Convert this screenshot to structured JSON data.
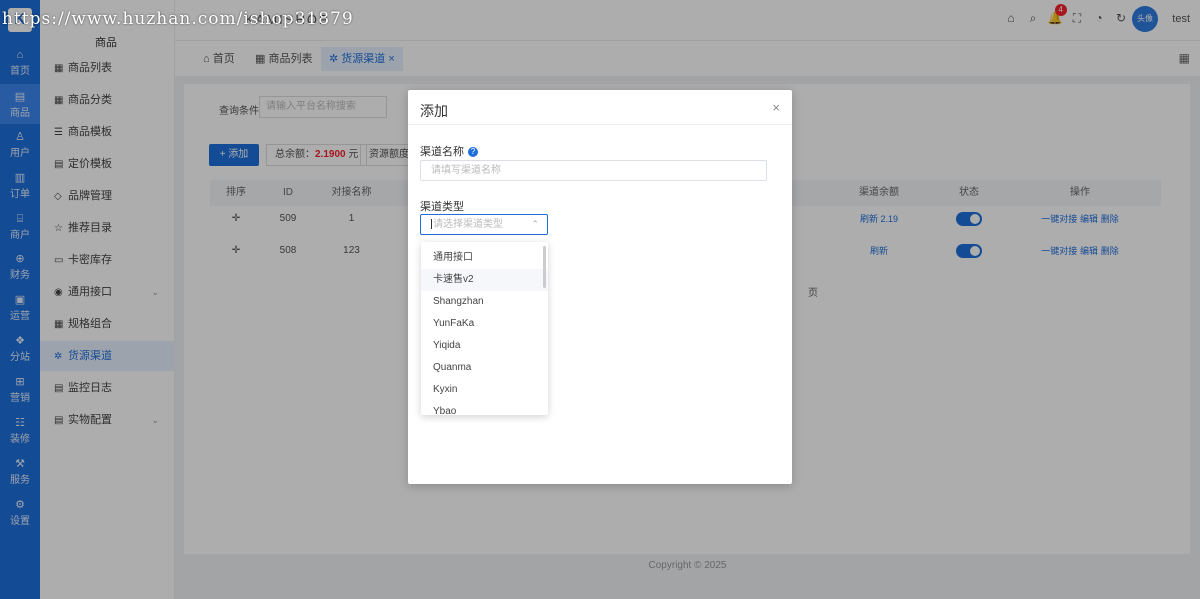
{
  "watermark": "https://www.huzhan.com/ishop31879",
  "rail": {
    "logo": "K",
    "items": [
      {
        "icon": "⌂",
        "label": "首页"
      },
      {
        "icon": "▤",
        "label": "商品"
      },
      {
        "icon": "♙",
        "label": "用户"
      },
      {
        "icon": "▥",
        "label": "订单"
      },
      {
        "icon": "⌸",
        "label": "商户"
      },
      {
        "icon": "⊕",
        "label": "财务"
      },
      {
        "icon": "▣",
        "label": "运营"
      },
      {
        "icon": "❖",
        "label": "分站"
      },
      {
        "icon": "⊞",
        "label": "营销"
      },
      {
        "icon": "☷",
        "label": "装修"
      },
      {
        "icon": "⚒",
        "label": "服务"
      },
      {
        "icon": "⚙",
        "label": "设置"
      }
    ]
  },
  "sidebar": {
    "title": "商品",
    "items": [
      {
        "icon": "▦",
        "label": "商品列表"
      },
      {
        "icon": "▦",
        "label": "商品分类"
      },
      {
        "icon": "☰",
        "label": "商品模板"
      },
      {
        "icon": "▤",
        "label": "定价模板"
      },
      {
        "icon": "◇",
        "label": "品牌管理"
      },
      {
        "icon": "☆",
        "label": "推荐目录"
      },
      {
        "icon": "▭",
        "label": "卡密库存"
      },
      {
        "icon": "◉",
        "label": "通用接口",
        "chevron": "⌄"
      },
      {
        "icon": "▦",
        "label": "规格组合"
      },
      {
        "icon": "✲",
        "label": "货源渠道"
      },
      {
        "icon": "▤",
        "label": "监控日志"
      },
      {
        "icon": "▤",
        "label": "实物配置",
        "chevron": "⌄"
      }
    ]
  },
  "header": {
    "brand": "KAMISHOP",
    "badge": "4",
    "avatar": "头像",
    "user": "test",
    "icons": [
      "⌂",
      "⌕",
      "🔔",
      "⛶",
      "◔",
      "↻",
      "⊡"
    ]
  },
  "tabs": [
    {
      "icon": "⌂",
      "label": "首页"
    },
    {
      "icon": "▦",
      "label": "商品列表"
    },
    {
      "icon": "✲",
      "label": "货源渠道",
      "close": "×"
    }
  ],
  "filter": {
    "label": "查询条件",
    "placeholder": "请输入平台名称搜索"
  },
  "toolbar": {
    "add": "+ 添加",
    "balance_label": "总余额：",
    "balance_value": "2.1900",
    "balance_unit": "元",
    "quota_label": "资源额度"
  },
  "table": {
    "headers": [
      "排序",
      "ID",
      "对接名称",
      "渠道余额",
      "状态",
      "操作"
    ],
    "rows": [
      {
        "sort": "✛",
        "id": "509",
        "name": "1",
        "balance": "刷新 2.19",
        "ops": [
          "一键对接",
          "编辑",
          "删除"
        ]
      },
      {
        "sort": "✛",
        "id": "508",
        "name": "123",
        "balance": "刷新",
        "ops": [
          "一键对接",
          "编辑",
          "删除"
        ]
      }
    ],
    "page_suffix": "页"
  },
  "footer": "Copyright © 2025",
  "modal": {
    "title": "添加",
    "close": "×",
    "name_label": "渠道名称",
    "name_placeholder": "请填写渠道名称",
    "type_label": "渠道类型",
    "type_placeholder": "请选择渠道类型",
    "caret": "⌃"
  },
  "dropdown": {
    "options": [
      "通用接口",
      "卡速售v2",
      "Shangzhan",
      "YunFaKa",
      "Yiqida",
      "Quanma",
      "Kyxin",
      "Ybao"
    ],
    "hovered_index": 1
  },
  "colors": {
    "accent": "#1e6fdc",
    "danger": "#f5222d"
  }
}
